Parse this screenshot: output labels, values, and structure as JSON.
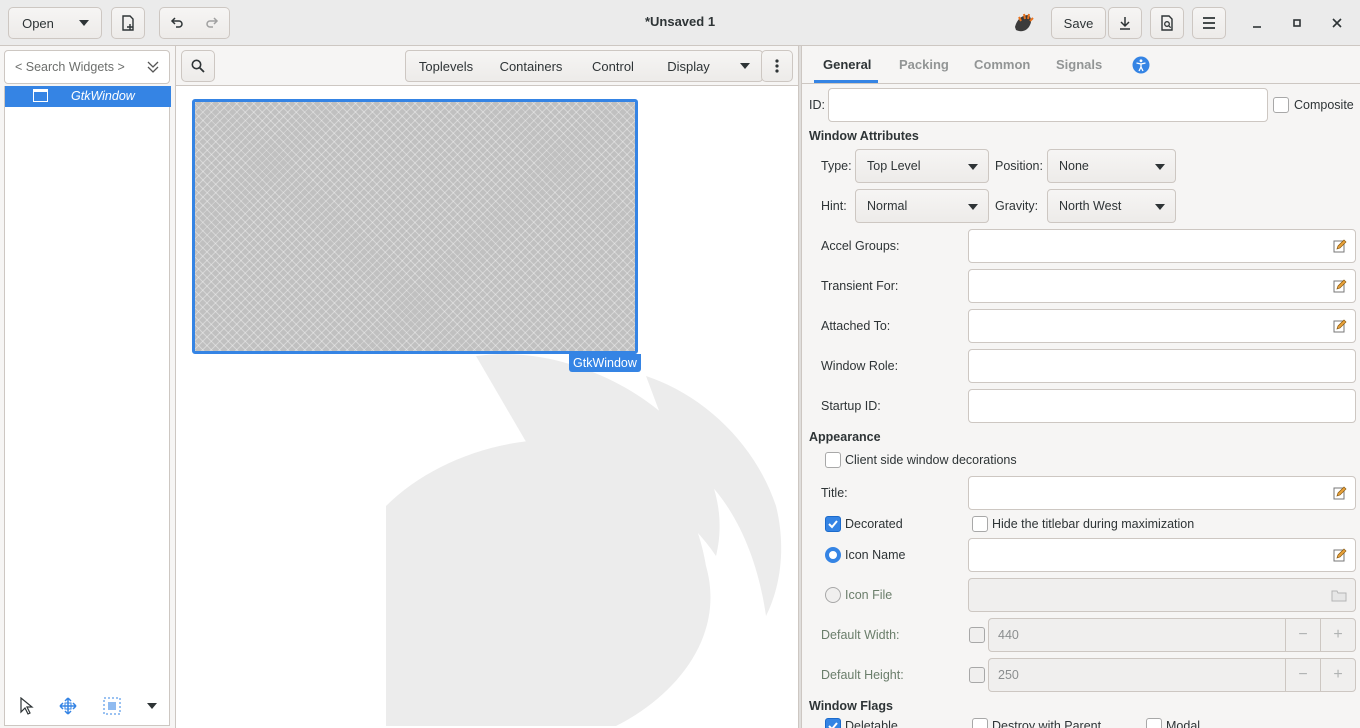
{
  "header": {
    "open_label": "Open",
    "title": "*Unsaved 1",
    "save_label": "Save"
  },
  "palette": {
    "search_placeholder": "< Search Widgets >",
    "tree": [
      {
        "label": "GtkWindow",
        "selected": true
      }
    ]
  },
  "center": {
    "categories": [
      "Toplevels",
      "Containers",
      "Control",
      "Display"
    ],
    "canvas_label": "GtkWindow"
  },
  "inspector": {
    "tabs": [
      "General",
      "Packing",
      "Common",
      "Signals"
    ],
    "active_tab": "General",
    "id_label": "ID:",
    "id_value": "",
    "composite_label": "Composite",
    "window_attributes": "Window Attributes",
    "type_label": "Type:",
    "type_value": "Top Level",
    "position_label": "Position:",
    "position_value": "None",
    "hint_label": "Hint:",
    "hint_value": "Normal",
    "gravity_label": "Gravity:",
    "gravity_value": "North West",
    "accel_groups_label": "Accel Groups:",
    "transient_for_label": "Transient For:",
    "attached_to_label": "Attached To:",
    "window_role_label": "Window Role:",
    "startup_id_label": "Startup ID:",
    "appearance": "Appearance",
    "csd_label": "Client side window decorations",
    "title_label": "Title:",
    "decorated_label": "Decorated",
    "hide_titlebar_label": "Hide the titlebar during maximization",
    "icon_name_label": "Icon Name",
    "icon_file_label": "Icon File",
    "default_width_label": "Default Width:",
    "default_width_value": "440",
    "default_height_label": "Default Height:",
    "default_height_value": "250",
    "window_flags": "Window Flags",
    "deletable_label": "Deletable",
    "destroy_with_parent_label": "Destroy with Parent",
    "modal_label": "Modal"
  },
  "colors": {
    "accent": "#3584e4",
    "window_bg": "#f6f5f4"
  }
}
